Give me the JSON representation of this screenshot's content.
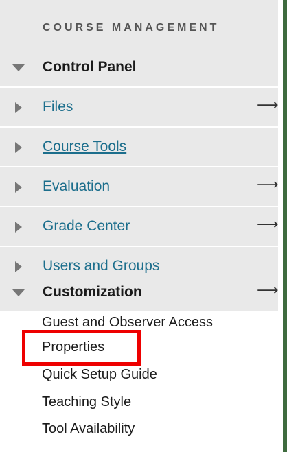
{
  "section": {
    "title": "COURSE MANAGEMENT"
  },
  "control_panel": {
    "label": "Control Panel",
    "items": [
      {
        "label": "Files",
        "arrow": "⟶"
      },
      {
        "label": "Course Tools"
      },
      {
        "label": "Evaluation",
        "arrow": "⟶"
      },
      {
        "label": "Grade Center",
        "arrow": "⟶"
      },
      {
        "label": "Users and Groups"
      }
    ]
  },
  "customization": {
    "label": "Customization",
    "arrow": "⟶",
    "subitems": [
      {
        "label": "Guest and Observer Access"
      },
      {
        "label": "Properties"
      },
      {
        "label": "Quick Setup Guide"
      },
      {
        "label": "Teaching Style"
      },
      {
        "label": "Tool Availability"
      }
    ]
  },
  "colors": {
    "background": "#e9e9e9",
    "link": "#1c6e8c",
    "highlight": "#ee0000",
    "text": "#1b1b1b"
  },
  "icons": {
    "collapsed": "triangle-right-icon",
    "expanded": "triangle-down-icon",
    "arrow": "long-right-arrow-icon"
  }
}
